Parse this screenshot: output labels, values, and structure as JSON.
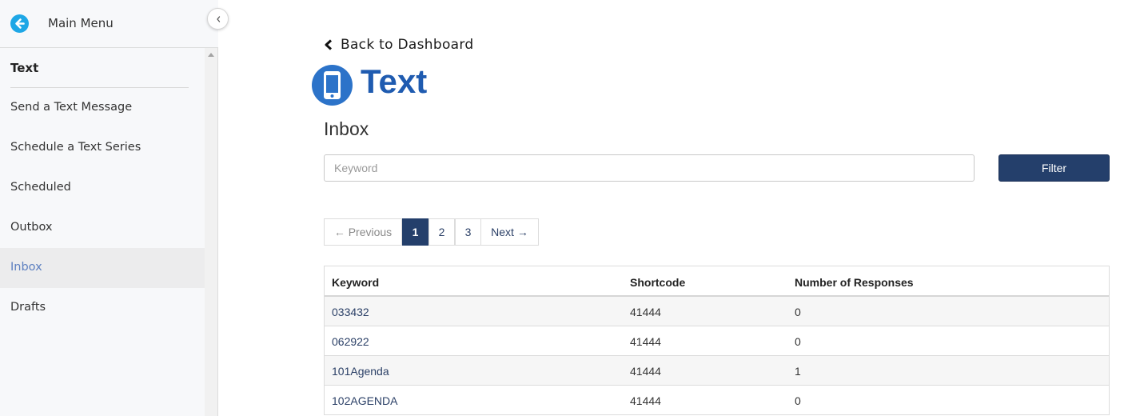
{
  "sidebar": {
    "header_title": "Main Menu",
    "section_title": "Text",
    "items": [
      {
        "label": "Send a Text Message"
      },
      {
        "label": "Schedule a Text Series"
      },
      {
        "label": "Scheduled"
      },
      {
        "label": "Outbox"
      },
      {
        "label": "Inbox"
      },
      {
        "label": "Drafts"
      }
    ],
    "active_item": "Inbox"
  },
  "main": {
    "back_link": "Back to Dashboard",
    "app_title": "Text",
    "page_heading": "Inbox",
    "search": {
      "placeholder": "Keyword",
      "value": ""
    },
    "filter_button": "Filter",
    "pagination": {
      "previous": "← Previous",
      "pages": [
        "1",
        "2",
        "3"
      ],
      "current_page": "1",
      "next": "Next →"
    },
    "table": {
      "columns": [
        "Keyword",
        "Shortcode",
        "Number of Responses"
      ],
      "rows": [
        [
          "033432",
          "41444",
          "0"
        ],
        [
          "062922",
          "41444",
          "0"
        ],
        [
          "101Agenda",
          "41444",
          "1"
        ],
        [
          "102AGENDA",
          "41444",
          "0"
        ]
      ]
    }
  },
  "colors": {
    "accent": "#243f6b",
    "title_blue": "#1f5bb0",
    "icon_blue": "#2c73c9",
    "back_button": "#1ea7e6",
    "active_sidebar_text": "#5c7fc0"
  },
  "icons": [
    "arrow-left-circle-icon",
    "chevron-left-icon",
    "smartphone-icon",
    "scroll-up-arrow-icon"
  ]
}
